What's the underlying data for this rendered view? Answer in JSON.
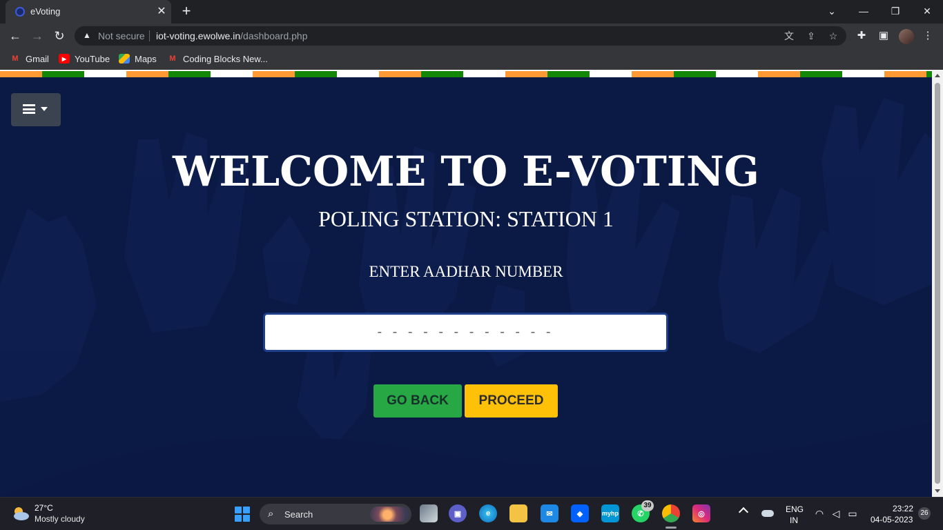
{
  "browser": {
    "tab_title": "eVoting",
    "security_label": "Not secure",
    "url_host": "iot-voting.ewolwe.in",
    "url_path": "/dashboard.php",
    "bookmarks": [
      {
        "label": "Gmail",
        "icon": "gmail-icon"
      },
      {
        "label": "YouTube",
        "icon": "youtube-icon"
      },
      {
        "label": "Maps",
        "icon": "maps-icon"
      },
      {
        "label": "Coding Blocks New...",
        "icon": "gmail-icon"
      }
    ]
  },
  "page": {
    "title": "WELCOME TO E-VOTING",
    "station": "POLING STATION: STATION 1",
    "aadhar_label": "ENTER AADHAR NUMBER",
    "aadhar_placeholder": "- - - - - - - - - - - -",
    "back_label": "GO BACK",
    "proceed_label": "PROCEED",
    "colors": {
      "background": "#0b1a45",
      "saffron": "#ff9933",
      "green": "#138808",
      "back_button": "#28a745",
      "proceed_button": "#ffc107"
    }
  },
  "taskbar": {
    "temperature": "27°C",
    "weather": "Mostly cloudy",
    "search_label": "Search",
    "whatsapp_badge": "39",
    "lang_top": "ENG",
    "lang_bottom": "IN",
    "time": "23:22",
    "date": "04-05-2023",
    "notifications": "26"
  }
}
